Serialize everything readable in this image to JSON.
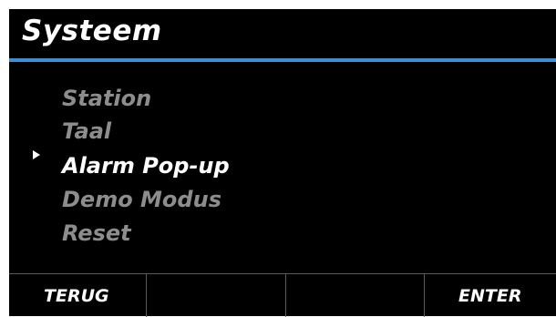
{
  "header": {
    "title": "Systeem"
  },
  "menu": {
    "items": [
      {
        "label": "Station",
        "selected": false
      },
      {
        "label": "Taal",
        "selected": false
      },
      {
        "label": "Alarm Pop-up",
        "selected": true
      },
      {
        "label": "Demo Modus",
        "selected": false
      },
      {
        "label": "Reset",
        "selected": false
      }
    ],
    "pointer_icon": "right-triangle-pointer"
  },
  "softkeys": {
    "left_label": "TERUG",
    "right_label": "ENTER"
  },
  "colors": {
    "background": "#000000",
    "accent": "#3f8fd6",
    "inactive_text": "#8d8d8d",
    "active_text": "#ffffff"
  }
}
